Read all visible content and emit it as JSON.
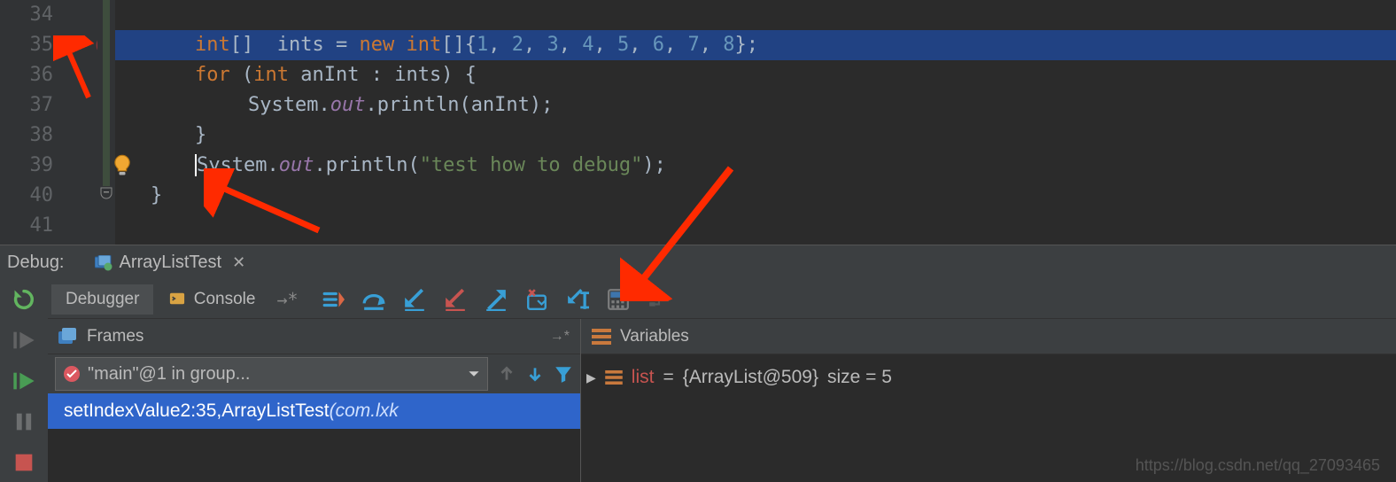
{
  "editor": {
    "lines": [
      {
        "num": 34,
        "tokens": []
      },
      {
        "num": 35,
        "highlight": true,
        "tokens": [
          {
            "t": "kw",
            "v": "int"
          },
          {
            "t": "punc",
            "v": "[] "
          },
          {
            "t": "ident",
            "v": "ints "
          },
          {
            "t": "op",
            "v": "= "
          },
          {
            "t": "kw",
            "v": "new int"
          },
          {
            "t": "punc",
            "v": "[]{"
          },
          {
            "t": "num",
            "v": "1"
          },
          {
            "t": "punc",
            "v": ", "
          },
          {
            "t": "num",
            "v": "2"
          },
          {
            "t": "punc",
            "v": ", "
          },
          {
            "t": "num",
            "v": "3"
          },
          {
            "t": "punc",
            "v": ", "
          },
          {
            "t": "num",
            "v": "4"
          },
          {
            "t": "punc",
            "v": ", "
          },
          {
            "t": "num",
            "v": "5"
          },
          {
            "t": "punc",
            "v": ", "
          },
          {
            "t": "num",
            "v": "6"
          },
          {
            "t": "punc",
            "v": ", "
          },
          {
            "t": "num",
            "v": "7"
          },
          {
            "t": "punc",
            "v": ", "
          },
          {
            "t": "num",
            "v": "8"
          },
          {
            "t": "punc",
            "v": "};"
          }
        ]
      },
      {
        "num": 36,
        "tokens": [
          {
            "t": "kw",
            "v": "for "
          },
          {
            "t": "punc",
            "v": "("
          },
          {
            "t": "kw",
            "v": "int "
          },
          {
            "t": "ident",
            "v": "anInt "
          },
          {
            "t": "punc",
            "v": ": "
          },
          {
            "t": "ident",
            "v": "ints"
          },
          {
            "t": "punc",
            "v": ") {"
          }
        ]
      },
      {
        "num": 37,
        "indent": 1,
        "tokens": [
          {
            "t": "ident",
            "v": "System."
          },
          {
            "t": "field",
            "v": "out"
          },
          {
            "t": "punc",
            "v": "."
          },
          {
            "t": "method",
            "v": "println"
          },
          {
            "t": "punc",
            "v": "("
          },
          {
            "t": "ident",
            "v": "anInt"
          },
          {
            "t": "punc",
            "v": ");"
          }
        ]
      },
      {
        "num": 38,
        "tokens": [
          {
            "t": "brace",
            "v": "}"
          }
        ]
      },
      {
        "num": 39,
        "lightbulb": true,
        "cursor": true,
        "tokens": [
          {
            "t": "ident",
            "v": "System."
          },
          {
            "t": "field",
            "v": "out"
          },
          {
            "t": "punc",
            "v": "."
          },
          {
            "t": "method",
            "v": "println"
          },
          {
            "t": "punc",
            "v": "("
          },
          {
            "t": "str",
            "v": "\"test how to debug\""
          },
          {
            "t": "punc",
            "v": ");"
          }
        ]
      },
      {
        "num": 40,
        "brace_only": true,
        "tokens": [
          {
            "t": "brace",
            "v": "}"
          }
        ],
        "outdent": 1
      },
      {
        "num": 41,
        "tokens": []
      }
    ]
  },
  "debugHeader": {
    "label": "Debug:",
    "tabName": "ArrayListTest"
  },
  "tabs": {
    "debugger": "Debugger",
    "console": "Console"
  },
  "frames": {
    "header": "Frames",
    "thread": "\"main\"@1 in group...",
    "stack_method": "setIndexValue2:35, ",
    "stack_class": "ArrayListTest ",
    "stack_pkg": "(com.lxk"
  },
  "variables": {
    "header": "Variables",
    "var_name": "list",
    "var_eq": " = ",
    "var_obj": "{ArrayList@509}",
    "var_size": "  size = 5"
  },
  "watermark": "https://blog.csdn.net/qq_27093465"
}
